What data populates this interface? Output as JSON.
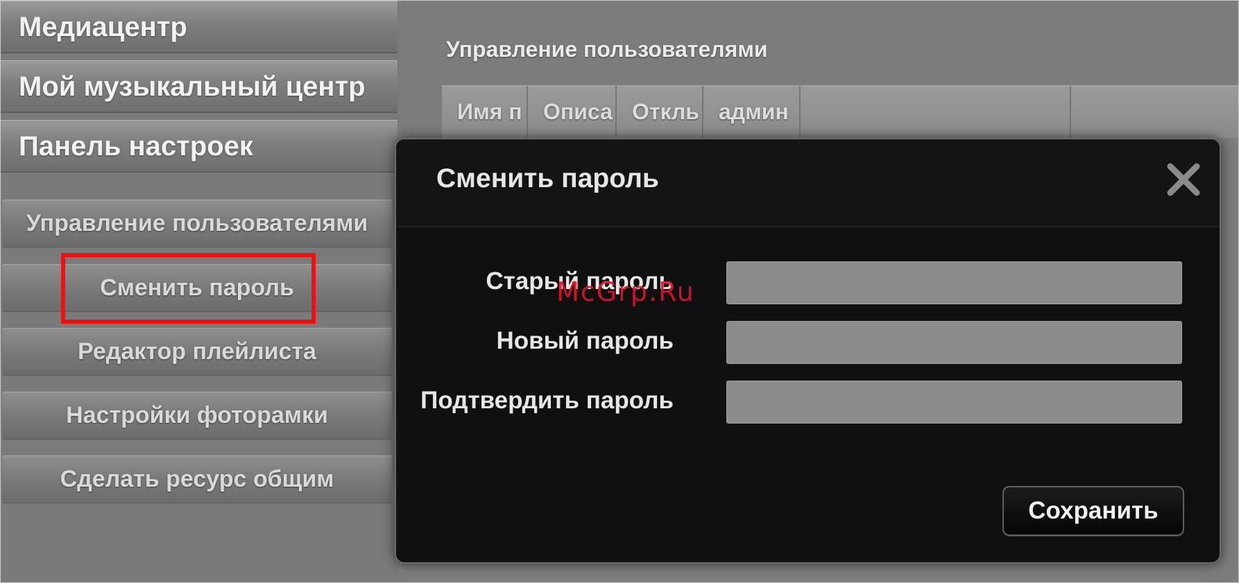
{
  "sidebar": {
    "main_items": [
      {
        "label": "Медиацентр"
      },
      {
        "label": "Мой музыкальный центр"
      },
      {
        "label": "Панель настроек"
      }
    ],
    "sub_items": [
      {
        "label": "Управление пользователями"
      },
      {
        "label": "Сменить пароль"
      },
      {
        "label": "Редактор плейлиста"
      },
      {
        "label": "Настройки фоторамки"
      },
      {
        "label": "Сделать ресурс общим"
      }
    ],
    "highlighted_item": "Сменить пароль",
    "highlight_color": "#f01010"
  },
  "content": {
    "title": "Управление пользователями",
    "table_headers": [
      "Имя п",
      "Описа",
      "Откль",
      "админ"
    ]
  },
  "modal": {
    "title": "Сменить пароль",
    "close_icon": "close-icon",
    "fields": [
      {
        "label": "Старый пароль",
        "value": ""
      },
      {
        "label": "Новый пароль",
        "value": ""
      },
      {
        "label": "Подтвердить пароль",
        "value": ""
      }
    ],
    "save_label": "Сохранить"
  },
  "watermark": "McGrp.Ru"
}
